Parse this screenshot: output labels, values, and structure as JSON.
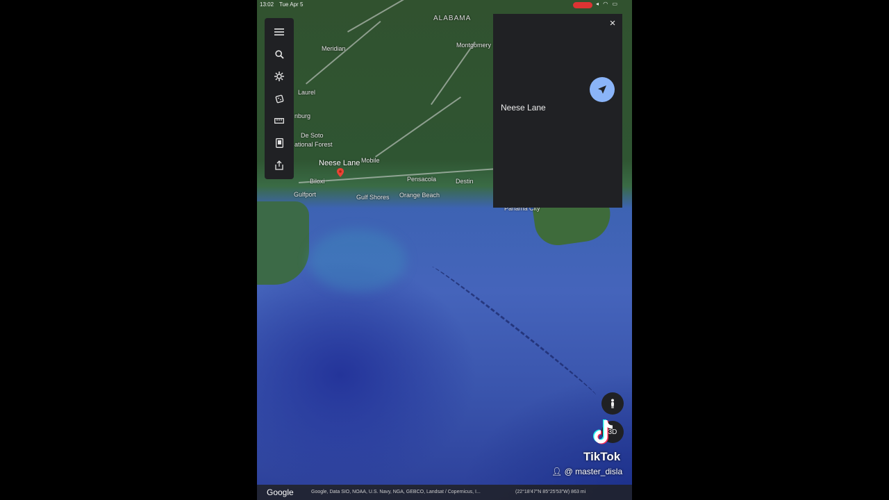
{
  "status_bar": {
    "time": "13:02",
    "date": "Tue Apr 5"
  },
  "map": {
    "labels": {
      "alabama": "ALABAMA",
      "montgomery": "Montgomery",
      "meridian": "Meridian",
      "laurel": "Laurel",
      "hattiesburg": "nburg",
      "de_soto": "De Soto",
      "national_forest": "ational Forest",
      "neese_lane": "Neese Lane",
      "mobile": "Mobile",
      "biloxi": "Biloxi",
      "gulfport": "Gulfport",
      "pensacola": "Pensacola",
      "destin": "Destin",
      "gulf_shores": "Gulf Shores",
      "orange_beach": "Orange Beach",
      "panama_city": "Panama City"
    }
  },
  "toolbar": {
    "menu_icon": "menu-icon",
    "search_icon": "search-icon",
    "voyager_icon": "voyager-icon",
    "dice_icon": "dice-icon",
    "ruler_icon": "ruler-icon",
    "projects_icon": "projects-icon",
    "share_icon": "share-icon"
  },
  "info_panel": {
    "place_name": "Neese Lane",
    "close_symbol": "×"
  },
  "controls": {
    "zoom_label": "3D"
  },
  "footer": {
    "logo": "Google",
    "attribution": "Google, Data SIO, NOAA, U.S. Navy, NGA, GEBCO, Landsat / Copernicus, I...",
    "coordinates": "(22°18'47\"N 85°25'53\"W) 863 mi"
  },
  "watermark": {
    "brand": "TikTok",
    "user": "@ master_disla"
  },
  "colors": {
    "panel_bg": "#202124",
    "accent": "#8ab4f8",
    "pin": "#ea4335"
  }
}
